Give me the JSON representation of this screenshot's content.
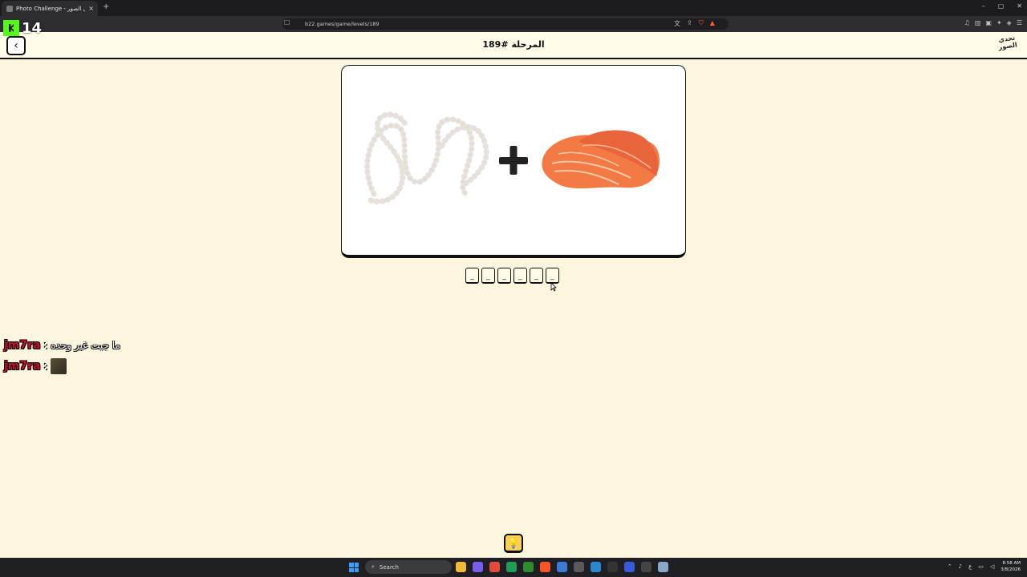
{
  "browser": {
    "tab_title": "Photo Challenge - لعبة تحدي الصور",
    "tab_close": "×",
    "new_tab": "+",
    "url": "b22.games/game/levels/189",
    "window_controls": [
      "–",
      "▢",
      "✕"
    ]
  },
  "stream_overlay": {
    "viewer_count": "14"
  },
  "header": {
    "back_icon": "‹",
    "title": "المرحلة #189",
    "logo_text": "تحدي الصور"
  },
  "puzzle": {
    "plus_symbol": "+",
    "slots": [
      "_",
      "_",
      "_",
      "_",
      "_",
      "_"
    ]
  },
  "chat": {
    "messages": [
      {
        "user": "jm7ra",
        "sep": ":",
        "text": "ما جبت غير وحده"
      },
      {
        "user": "jm7ra",
        "sep": ":",
        "text": ""
      }
    ]
  },
  "hint_button": {
    "icon": "💡"
  },
  "taskbar": {
    "search_label": "Search",
    "time": "8:58 AM",
    "date": "3/8/2026",
    "lang": "ع"
  },
  "colors": {
    "page_bg": "#fdf6df",
    "header_bg": "#fffbe8",
    "hint_bg": "#f9ce5a",
    "chat_user": "#c8102e",
    "kick_green": "#53fc18"
  }
}
